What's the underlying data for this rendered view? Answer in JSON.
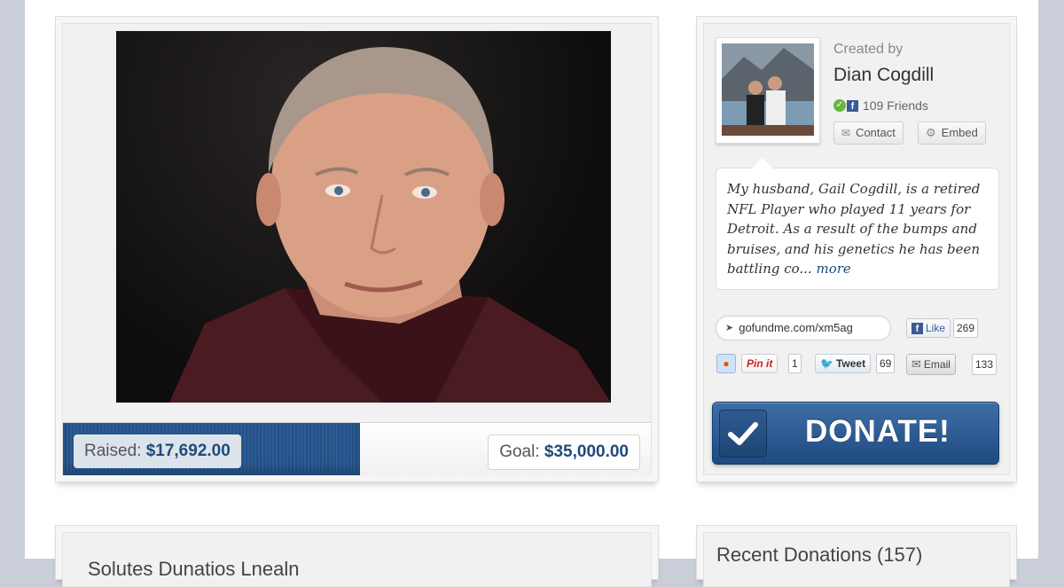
{
  "campaign": {
    "raised_label": "Raised:",
    "raised_amount": "$17,692.00",
    "goal_label": "Goal:",
    "goal_amount": "$35,000.00",
    "progress_fraction": 0.505
  },
  "creator": {
    "created_by": "Created by",
    "name": "Dian Cogdill",
    "friends": "109 Friends",
    "contact_label": "Contact",
    "embed_label": "Embed"
  },
  "story": {
    "excerpt": "My husband, Gail Cogdill, is a retired NFL Player who played 11 years for Detroit. As a result of the bumps and bruises, and his genetics he has been battling co...",
    "more_label": "more"
  },
  "share": {
    "short_url": "gofundme.com/xm5ag",
    "like_label": "Like",
    "like_count": "269",
    "pin_label": "Pin it",
    "pin_count": "1",
    "tweet_label": "Tweet",
    "tweet_count": "69",
    "email_label": "Email",
    "email_count": "133"
  },
  "donate_label": "DONATE!",
  "sections": {
    "summary_title": "Solutes Dunatios Lnealn",
    "recent_title": "Recent Donations (157)"
  },
  "colors": {
    "accent": "#1f4b7a",
    "donate_top": "#3f6ea6",
    "donate_bottom": "#1e4a80"
  },
  "icons": [
    "check-icon",
    "facebook-icon",
    "mail-icon",
    "gear-icon",
    "cursor-icon",
    "reddit-icon",
    "twitter-icon"
  ]
}
